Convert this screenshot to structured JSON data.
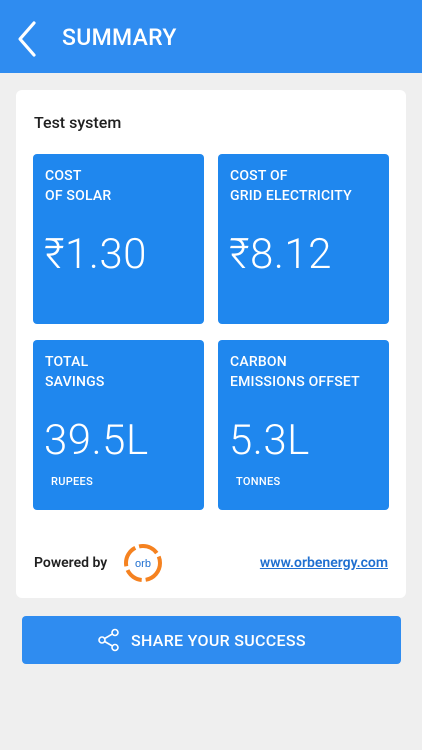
{
  "header": {
    "title": "SUMMARY",
    "back_icon": "chevron-left-icon",
    "bg_color": "#2f8cf0"
  },
  "card": {
    "system_name": "Test system",
    "tiles": [
      {
        "label_line1": "COST",
        "label_line2": "OF SOLAR",
        "value": "₹1.30",
        "unit": ""
      },
      {
        "label_line1": "COST OF",
        "label_line2": "GRID ELECTRICITY",
        "value": "₹8.12",
        "unit": ""
      },
      {
        "label_line1": "TOTAL",
        "label_line2": "SAVINGS",
        "value": "39.5L",
        "unit": "RUPEES"
      },
      {
        "label_line1": "CARBON",
        "label_line2": "EMISSIONS OFFSET",
        "value": "5.3L",
        "unit": "TONNES"
      }
    ],
    "tile_color": "#1f87ee",
    "powered_by": "Powered by",
    "logo_text": "orb",
    "website": "www.orbenergy.com"
  },
  "share": {
    "label": "SHARE YOUR SUCCESS",
    "icon": "share-icon"
  }
}
